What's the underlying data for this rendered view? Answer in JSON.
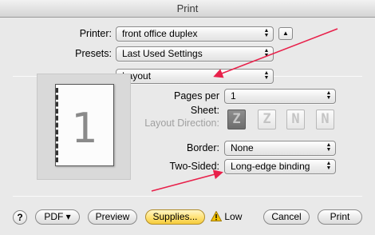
{
  "window": {
    "title": "Print"
  },
  "printer": {
    "label": "Printer:",
    "value": "front office duplex"
  },
  "presets": {
    "label": "Presets:",
    "value": "Last Used Settings"
  },
  "pane": {
    "value": "Layout"
  },
  "preview": {
    "page_number": "1"
  },
  "layout": {
    "pages_per_sheet": {
      "label": "Pages per Sheet:",
      "value": "1"
    },
    "layout_direction": {
      "label": "Layout Direction:",
      "options": [
        "Z",
        "Z",
        "N",
        "N"
      ]
    },
    "border": {
      "label": "Border:",
      "value": "None"
    },
    "two_sided": {
      "label": "Two-Sided:",
      "value": "Long-edge binding"
    }
  },
  "footer": {
    "help": "?",
    "pdf": "PDF ▾",
    "preview": "Preview",
    "supplies": "Supplies...",
    "ink_level": "Low",
    "cancel": "Cancel",
    "print": "Print"
  },
  "annotation": {
    "color": "#e8204a"
  },
  "colors": {
    "supplies_button": "#f6cc3c",
    "warning": "#f2c200"
  }
}
